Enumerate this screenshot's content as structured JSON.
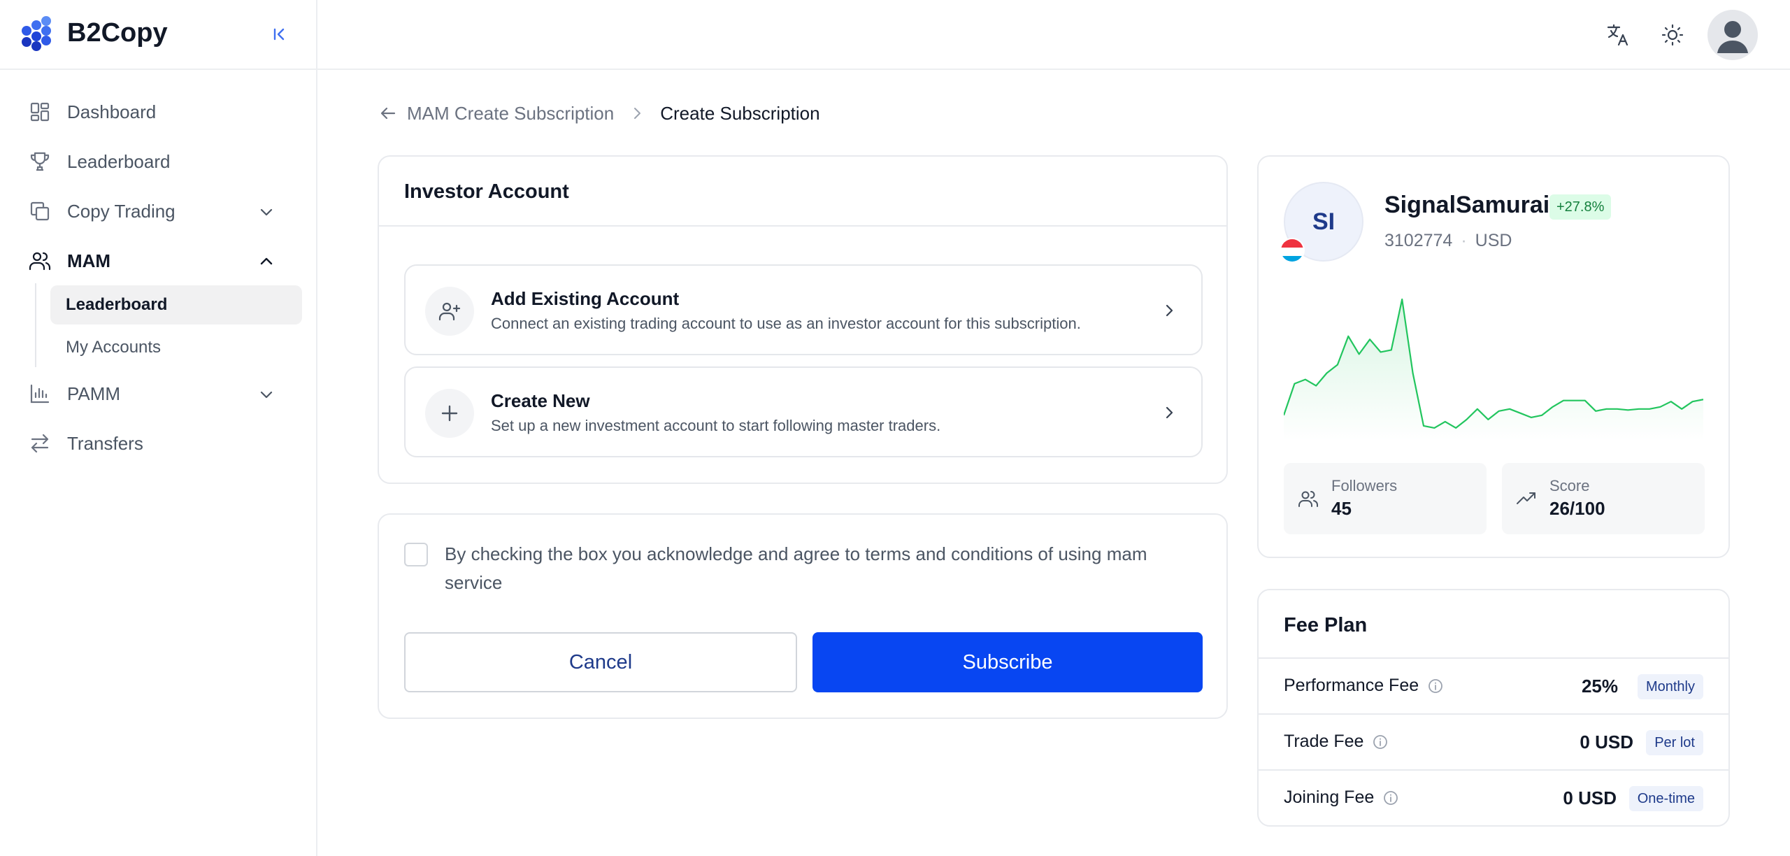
{
  "app": {
    "name": "B2Copy"
  },
  "sidebar": {
    "items": [
      {
        "label": "Dashboard",
        "icon": "dashboard-icon"
      },
      {
        "label": "Leaderboard",
        "icon": "trophy-icon"
      },
      {
        "label": "Copy Trading",
        "icon": "copy-icon"
      },
      {
        "label": "MAM",
        "icon": "users-icon"
      },
      {
        "label": "PAMM",
        "icon": "bar-chart-icon"
      },
      {
        "label": "Transfers",
        "icon": "transfer-icon"
      }
    ],
    "mam_sub": [
      {
        "label": "Leaderboard",
        "selected": true
      },
      {
        "label": "My Accounts",
        "selected": false
      }
    ]
  },
  "breadcrumb": {
    "parent": "MAM Create Subscription",
    "current": "Create Subscription"
  },
  "investor": {
    "title": "Investor Account",
    "options": [
      {
        "title": "Add Existing Account",
        "desc": "Connect an existing trading account to use as an investor account for this subscription.",
        "icon": "user-plus-icon"
      },
      {
        "title": "Create New",
        "desc": "Set up a new investment account to start following master traders.",
        "icon": "plus-icon"
      }
    ]
  },
  "agreement": {
    "text": "By checking the box you acknowledge and agree to terms and conditions of using mam service",
    "checked": false,
    "cancel_label": "Cancel",
    "subscribe_label": "Subscribe"
  },
  "trader": {
    "initials": "SI",
    "name": "SignalSamurai",
    "change": "+27.8%",
    "account": "3102774",
    "currency": "USD",
    "followers_label": "Followers",
    "followers": "45",
    "score_label": "Score",
    "score": "26/100"
  },
  "fee_plan": {
    "title": "Fee Plan",
    "rows": [
      {
        "name": "Performance Fee",
        "value": "25%",
        "tag": "Monthly"
      },
      {
        "name": "Trade Fee",
        "value": "0 USD",
        "tag": "Per lot"
      },
      {
        "name": "Joining Fee",
        "value": "0 USD",
        "tag": "One-time"
      }
    ]
  },
  "colors": {
    "primary": "#0846f2",
    "positive": "#22c55e",
    "brand_blue": "#1e3a8a"
  },
  "chart_data": {
    "type": "area",
    "x": [
      0,
      1,
      2,
      3,
      4,
      5,
      6,
      7,
      8,
      9,
      10,
      11,
      12,
      13,
      14,
      15,
      16,
      17,
      18,
      19,
      20,
      21,
      22,
      23,
      24,
      25,
      26,
      27,
      28,
      29,
      30,
      31,
      32,
      33,
      34,
      35,
      36,
      37,
      38,
      39
    ],
    "values": [
      20,
      50,
      54,
      48,
      60,
      68,
      95,
      78,
      92,
      80,
      82,
      130,
      60,
      10,
      8,
      14,
      8,
      16,
      26,
      16,
      24,
      26,
      22,
      18,
      20,
      28,
      34,
      34,
      34,
      24,
      26,
      26,
      25,
      26,
      26,
      28,
      33,
      26,
      33,
      35
    ],
    "series_color": "#22c55e"
  }
}
